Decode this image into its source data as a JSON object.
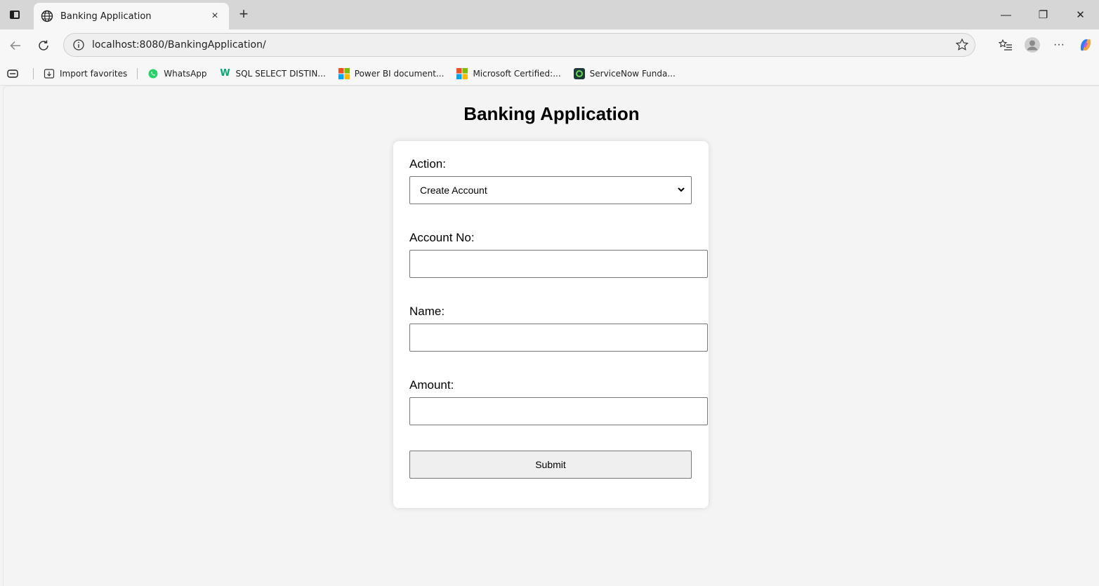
{
  "browser": {
    "tab_title": "Banking Application",
    "tab_close": "×",
    "new_tab": "+",
    "url": "localhost:8080/BankingApplication/",
    "bookmarks": [
      {
        "label": "Import favorites",
        "icon": "import-favorites-icon"
      },
      {
        "label": "WhatsApp",
        "icon": "whatsapp-icon"
      },
      {
        "label": "SQL SELECT DISTIN...",
        "icon": "w3schools-icon"
      },
      {
        "label": "Power BI document...",
        "icon": "microsoft-icon"
      },
      {
        "label": "Microsoft Certified:...",
        "icon": "microsoft-icon"
      },
      {
        "label": "ServiceNow Funda...",
        "icon": "servicenow-icon"
      }
    ],
    "more_label": "···",
    "window_controls": {
      "minimize": "—",
      "restore": "❐",
      "close": "✕"
    }
  },
  "page": {
    "title": "Banking Application",
    "form": {
      "action_label": "Action:",
      "action_selected": "Create Account",
      "account_label": "Account No:",
      "account_value": "",
      "name_label": "Name:",
      "name_value": "",
      "amount_label": "Amount:",
      "amount_value": "",
      "submit_label": "Submit"
    }
  },
  "colors": {
    "page_bg": "#f4f4f4",
    "card_bg": "#ffffff",
    "chrome_bg": "#d6d6d6",
    "toolbar_bg": "#f7f7f7"
  }
}
